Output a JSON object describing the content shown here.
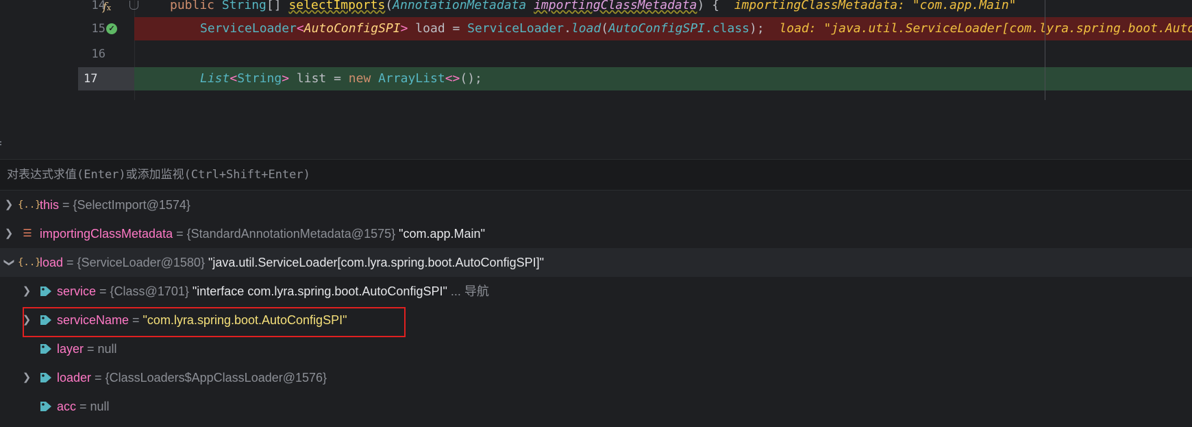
{
  "editor": {
    "lines": [
      {
        "number": "14",
        "tokens": {
          "kw": "public",
          "type": "String",
          "arr": "[]",
          "fn": "selectImports",
          "p1": "(",
          "ptype": "AnnotationMetadata",
          "pname": "importingClassMetadata",
          "p2": ") {"
        },
        "hint": "importingClassMetadata: \"com.app.Main\""
      },
      {
        "number": "15",
        "tokens": {
          "t1": "ServiceLoader",
          "lt": "<",
          "t2": "AutoConfigSPI",
          "gt": ">",
          "v": " load = ",
          "t3": "ServiceLoader",
          "dot": ".",
          "fn": "load",
          "p1": "(",
          "t4": "AutoConfigSPI",
          "cls": ".class",
          "p2": ");"
        },
        "hint": "load: \"java.util.ServiceLoader[com.lyra.spring.boot.AutoConfigSPI]\""
      },
      {
        "number": "16"
      },
      {
        "number": "17",
        "tokens": {
          "t1": "List",
          "lt": "<",
          "t2": "String",
          "gt": ">",
          "v": " list = ",
          "kw": "new",
          "sp": " ",
          "t3": "ArrayList",
          "dia": "<>",
          "end": "();"
        }
      }
    ],
    "icons": {
      "method": "fx-icon",
      "breakpoint": "check-icon",
      "fold": "fold-icon"
    },
    "colors": {
      "breakpoint_line": "#5a1d1d",
      "current_line": "#2b4a37"
    }
  },
  "evaluate": {
    "placeholder": "对表达式求值(Enter)或添加监视(Ctrl+Shift+Enter)"
  },
  "variables": [
    {
      "expanded": false,
      "icon": "object-icon",
      "name": "this",
      "eq": " = ",
      "ref": "{SelectImport@1574}"
    },
    {
      "expanded": false,
      "icon": "parameter-icon",
      "name": "importingClassMetadata",
      "eq": " = ",
      "ref": "{StandardAnnotationMetadata@1575}",
      "value": " \"com.app.Main\""
    },
    {
      "expanded": true,
      "icon": "object-icon",
      "name": "load",
      "eq": " = ",
      "ref": "{ServiceLoader@1580}",
      "value": " \"java.util.ServiceLoader[com.lyra.spring.boot.AutoConfigSPI]\""
    },
    {
      "expanded": false,
      "icon": "field-icon",
      "name": "service",
      "eq": " = ",
      "ref": "{Class@1701}",
      "value": " \"interface com.lyra.spring.boot.AutoConfigSPI\"",
      "nav": " ... 导航"
    },
    {
      "expanded": false,
      "icon": "field-icon",
      "name": "serviceName",
      "eq": " = ",
      "value": "\"com.lyra.spring.boot.AutoConfigSPI\""
    },
    {
      "icon": "field-icon",
      "name": "layer",
      "eq": " = ",
      "null": "null"
    },
    {
      "expanded": false,
      "icon": "field-icon",
      "name": "loader",
      "eq": " = ",
      "ref": "{ClassLoaders$AppClassLoader@1576}"
    },
    {
      "icon": "field-icon",
      "name": "acc",
      "eq": " = ",
      "null": "null"
    }
  ],
  "highlight_color": "#e02020"
}
